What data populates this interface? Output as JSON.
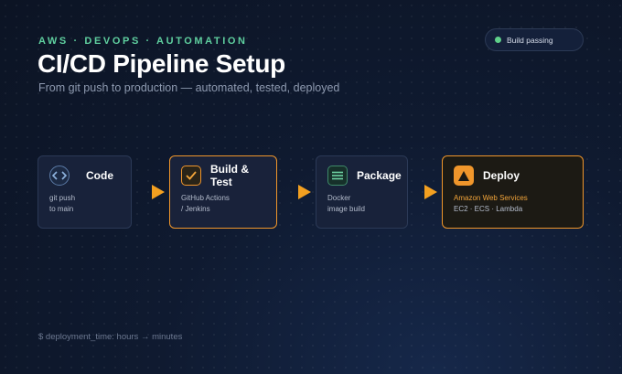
{
  "header": {
    "eyebrow": "AWS · DEVOPS · AUTOMATION",
    "title": "CI/CD Pipeline Setup",
    "subtitle": "From git push to production — automated, tested, deployed"
  },
  "status": {
    "label": "Build passing",
    "color": "#5fd08a"
  },
  "stages": [
    {
      "label": "Code",
      "icon": "code-chevrons-icon",
      "desc_line1": "git push",
      "desc_line2": "to main"
    },
    {
      "label": "Build & Test",
      "icon": "checkbox-check-icon",
      "desc_line1": "GitHub Actions",
      "desc_line2": "/ Jenkins"
    },
    {
      "label": "Package",
      "icon": "package-lines-icon",
      "desc_line1": "Docker",
      "desc_line2": "image build"
    },
    {
      "label": "Deploy",
      "icon": "warning-triangle-icon",
      "desc_line1": "Amazon Web Services",
      "desc_line2": "EC2 · ECS · Lambda"
    }
  ],
  "footer": {
    "command": "$ deployment_time: hours → minutes"
  },
  "colors": {
    "accent_orange": "#f0962b",
    "accent_green": "#5fcf9f",
    "background": "#0f1a30"
  }
}
